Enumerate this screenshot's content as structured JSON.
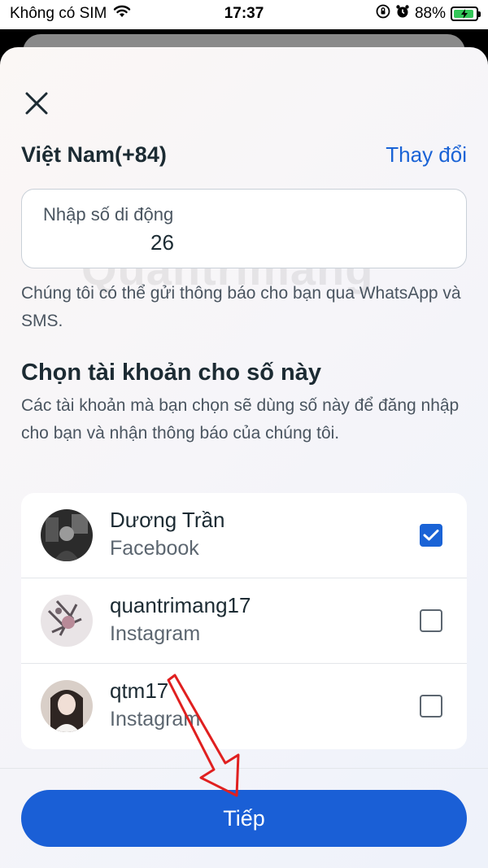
{
  "status_bar": {
    "carrier": "Không có SIM",
    "time": "17:37",
    "battery_percent": "88%"
  },
  "header": {
    "country": "Việt Nam(+84)",
    "change_label": "Thay đổi"
  },
  "phone_input": {
    "label": "Nhập số di động",
    "value": "26"
  },
  "hint_text": "Chúng tôi có thể gửi thông báo cho bạn qua WhatsApp và SMS.",
  "accounts_section": {
    "title": "Chọn tài khoản cho số này",
    "description": "Các tài khoản mà bạn chọn sẽ dùng số này để đăng nhập cho bạn và nhận thông báo của chúng tôi."
  },
  "accounts": [
    {
      "name": "Dương Trần",
      "platform": "Facebook",
      "checked": true
    },
    {
      "name": "quantrimang17",
      "platform": "Instagram",
      "checked": false
    },
    {
      "name": "qtm17",
      "platform": "Instagram",
      "checked": false
    }
  ],
  "next_button": "Tiếp",
  "watermark": "Quantrimang",
  "colors": {
    "accent": "#1a5fd6",
    "link": "#1a63d6",
    "arrow": "#e02020",
    "battery": "#34c759"
  }
}
